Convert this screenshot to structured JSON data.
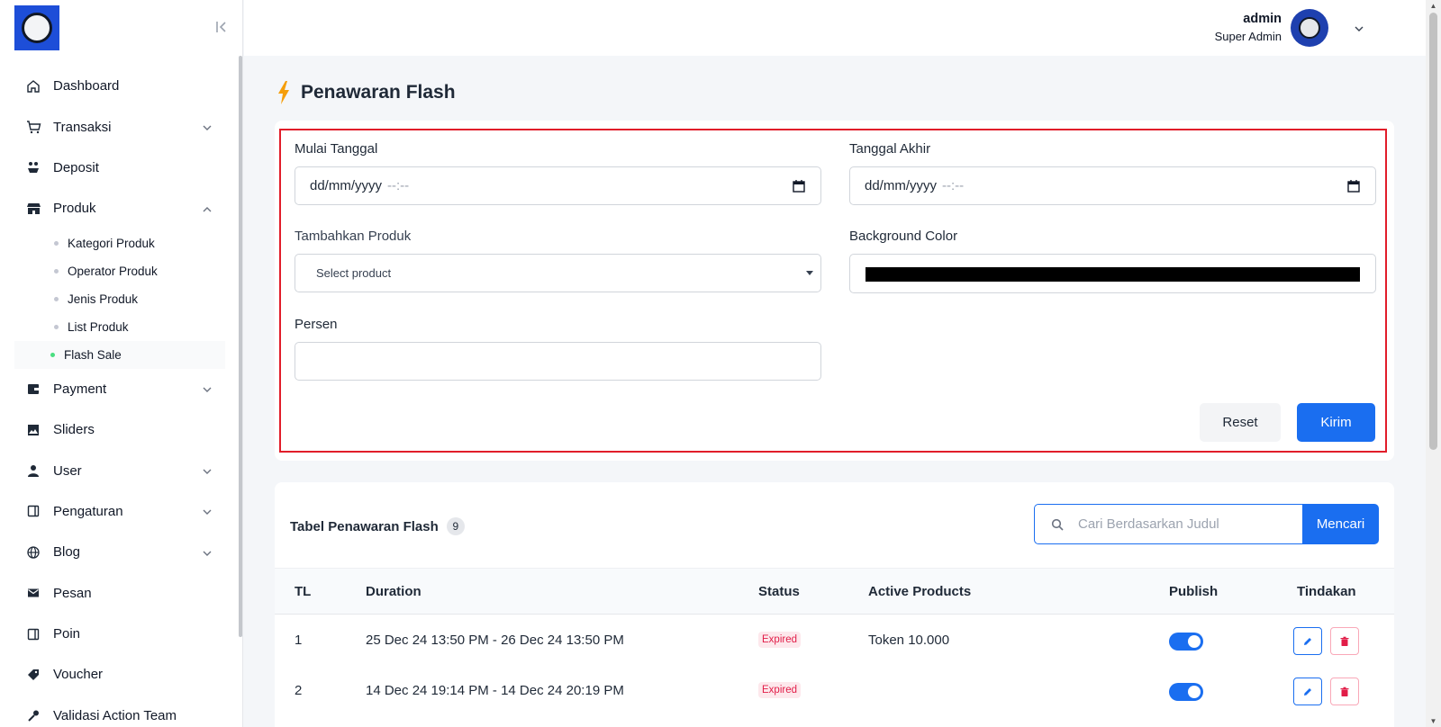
{
  "sidebar": {
    "items": [
      {
        "label": "Dashboard",
        "icon": "home-icon",
        "expandable": false
      },
      {
        "label": "Transaksi",
        "icon": "cart-icon",
        "expandable": true
      },
      {
        "label": "Deposit",
        "icon": "deposit-icon",
        "expandable": false
      },
      {
        "label": "Produk",
        "icon": "store-icon",
        "expandable": true,
        "expanded": true
      },
      {
        "label": "Payment",
        "icon": "wallet-icon",
        "expandable": true
      },
      {
        "label": "Sliders",
        "icon": "image-icon",
        "expandable": false
      },
      {
        "label": "User",
        "icon": "user-icon",
        "expandable": true
      },
      {
        "label": "Pengaturan",
        "icon": "settings-panel-icon",
        "expandable": true
      },
      {
        "label": "Blog",
        "icon": "globe-icon",
        "expandable": true
      },
      {
        "label": "Pesan",
        "icon": "mail-icon",
        "expandable": false
      },
      {
        "label": "Poin",
        "icon": "points-icon",
        "expandable": false
      },
      {
        "label": "Voucher",
        "icon": "tag-icon",
        "expandable": false
      },
      {
        "label": "Validasi Action Team",
        "icon": "wrench-icon",
        "expandable": false
      }
    ],
    "produk_sub": [
      {
        "label": "Kategori Produk",
        "active": false
      },
      {
        "label": "Operator Produk",
        "active": false
      },
      {
        "label": "Jenis Produk",
        "active": false
      },
      {
        "label": "List Produk",
        "active": false
      },
      {
        "label": "Flash Sale",
        "active": true
      }
    ]
  },
  "header": {
    "user_name": "admin",
    "user_role": "Super Admin"
  },
  "page": {
    "title": "Penawaran Flash"
  },
  "form": {
    "start_label": "Mulai Tanggal",
    "start_value": "dd/mm/yyyy",
    "start_time": "--:--",
    "end_label": "Tanggal Akhir",
    "end_value": "dd/mm/yyyy",
    "end_time": "--:--",
    "product_label": "Tambahkan Produk",
    "product_placeholder": "Select product",
    "bg_color_label": "Background Color",
    "bg_color_value": "#000000",
    "percent_label": "Persen",
    "percent_value": "",
    "reset_label": "Reset",
    "submit_label": "Kirim"
  },
  "table": {
    "title": "Tabel Penawaran Flash",
    "count": "9",
    "search_placeholder": "Cari Berdasarkan Judul",
    "search_button": "Mencari",
    "columns": [
      "TL",
      "Duration",
      "Status",
      "Active Products",
      "Publish",
      "Tindakan"
    ],
    "rows": [
      {
        "tl": "1",
        "duration": "25 Dec 24 13:50 PM - 26 Dec 24 13:50 PM",
        "status": "Expired",
        "products": "Token 10.000",
        "publish": true
      },
      {
        "tl": "2",
        "duration": "14 Dec 24 19:14 PM - 14 Dec 24 20:19 PM",
        "status": "Expired",
        "products": "",
        "publish": true
      }
    ]
  },
  "colors": {
    "primary": "#1a6ef0",
    "danger": "#e11d48",
    "highlight_frame": "#e11d2a",
    "bolt": "#f59e0b"
  }
}
